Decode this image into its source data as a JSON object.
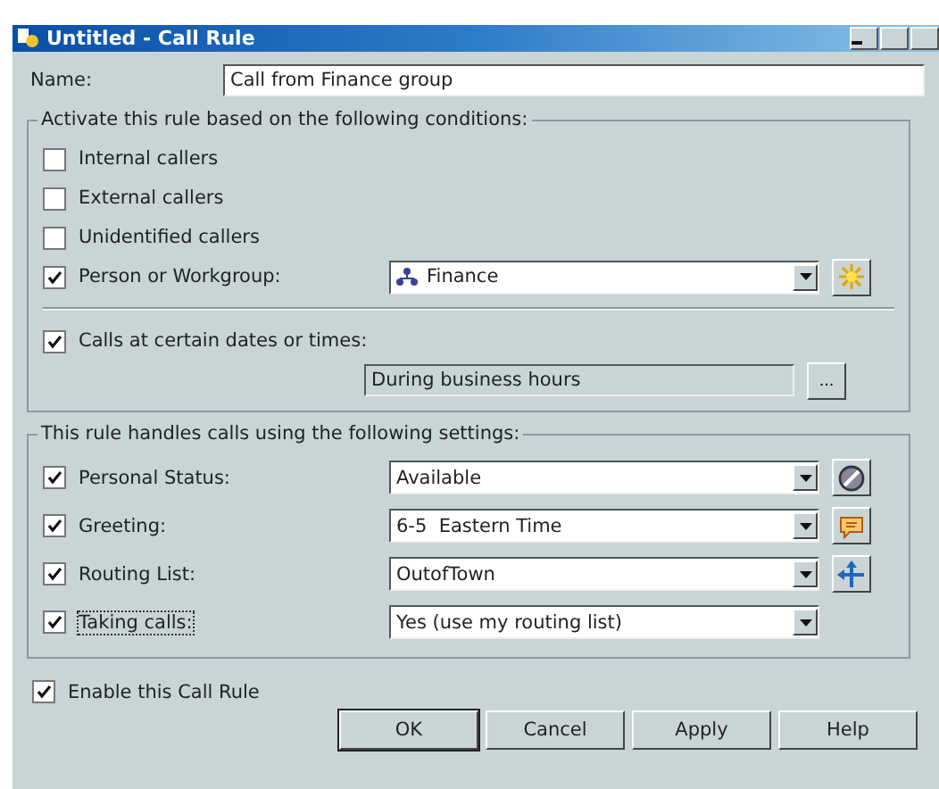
{
  "window": {
    "title": "Untitled - Call Rule"
  },
  "name_field": {
    "label": "Name:",
    "value": "Call from Finance group"
  },
  "conditions": {
    "title": "Activate this rule based on the following conditions:",
    "items": [
      {
        "kind": "checkbox",
        "label": "Internal callers",
        "checked": false
      },
      {
        "kind": "checkbox",
        "label": "External callers",
        "checked": false
      },
      {
        "kind": "checkbox",
        "label": "Unidentified callers",
        "checked": false
      },
      {
        "kind": "workgroup",
        "label": "Person or Workgroup:",
        "checked": true,
        "value": "Finance"
      },
      {
        "kind": "dates",
        "label": "Calls at certain dates or times:",
        "checked": true,
        "value": "During business hours",
        "button": "..."
      }
    ]
  },
  "settings": {
    "title": "This rule handles calls using the following settings:",
    "items": [
      {
        "kind": "status",
        "label": "Personal Status:",
        "checked": true,
        "value": "Available"
      },
      {
        "kind": "greeting",
        "label": "Greeting:",
        "checked": true,
        "value": "6-5  Eastern Time"
      },
      {
        "kind": "routing",
        "label": "Routing List:",
        "checked": true,
        "value": "OutofTown"
      },
      {
        "kind": "plain",
        "label": "Taking calls:",
        "checked": true,
        "value": "Yes (use my routing list)",
        "focused": true
      }
    ]
  },
  "enable": {
    "label": "Enable this Call Rule",
    "checked": true
  },
  "buttons": [
    {
      "label": "OK",
      "default": true
    },
    {
      "label": "Cancel",
      "default": false
    },
    {
      "label": "Apply",
      "default": false
    },
    {
      "label": "Help",
      "default": false
    }
  ]
}
